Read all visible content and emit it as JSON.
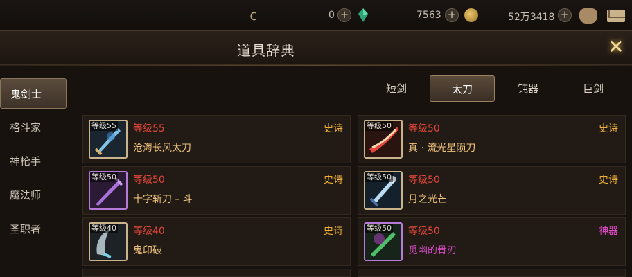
{
  "topbar": {
    "currencies": [
      {
        "value": "0"
      },
      {
        "value": "7563"
      },
      {
        "value": "52万3418"
      }
    ],
    "icons": [
      "c-currency-icon",
      "plus-icon",
      "green-gem-icon",
      "gold-coin-icon",
      "bag-icon",
      "mail-icon"
    ]
  },
  "title": "道具辞典",
  "classes": [
    {
      "label": "鬼剑士",
      "active": true
    },
    {
      "label": "格斗家",
      "active": false
    },
    {
      "label": "神枪手",
      "active": false
    },
    {
      "label": "魔法师",
      "active": false
    },
    {
      "label": "圣职者",
      "active": false
    }
  ],
  "tabs": [
    {
      "label": "短剑",
      "active": false
    },
    {
      "label": "太刀",
      "active": true
    },
    {
      "label": "钝器",
      "active": false
    },
    {
      "label": "巨剑",
      "active": false
    }
  ],
  "items": [
    {
      "level_tag": "等级55",
      "level": "等级55",
      "name": "沧海长风太刀",
      "rarity": "史诗",
      "rarity_color": "#f0b036"
    },
    {
      "level_tag": "等级50",
      "level": "等级50",
      "name": "真 · 流光星陨刀",
      "rarity": "史诗",
      "rarity_color": "#f0b036"
    },
    {
      "level_tag": "等级50",
      "level": "等级50",
      "name": "十字斩刀 – 斗",
      "rarity": "史诗",
      "rarity_color": "#f0b036"
    },
    {
      "level_tag": "等级50",
      "level": "等级50",
      "name": "月之光芒",
      "rarity": "史诗",
      "rarity_color": "#f0b036"
    },
    {
      "level_tag": "等级40",
      "level": "等级40",
      "name": "鬼印破",
      "rarity": "史诗",
      "rarity_color": "#f0b036"
    },
    {
      "level_tag": "等级50",
      "level": "等级50",
      "name": "觅幽的骨刃",
      "rarity": "神器",
      "rarity_color": "#e049c6"
    }
  ]
}
